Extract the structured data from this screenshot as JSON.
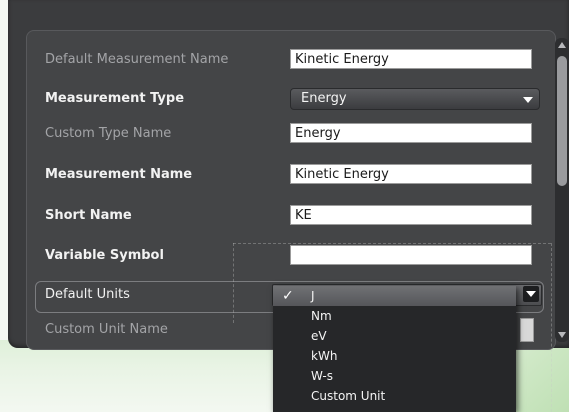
{
  "form": {
    "rows": [
      {
        "label": "Default Measurement Name",
        "value": "Kinetic Energy"
      },
      {
        "label": "Measurement Type",
        "value": "Energy"
      },
      {
        "label": "Custom Type Name",
        "value": "Energy"
      },
      {
        "label": "Measurement Name",
        "value": "Kinetic Energy"
      },
      {
        "label": "Short Name",
        "value": "KE"
      },
      {
        "label": "Variable Symbol",
        "value": ""
      },
      {
        "label": "Default Units",
        "value": "J"
      },
      {
        "label": "Custom Unit Name",
        "value": ""
      }
    ]
  },
  "units_dropdown": {
    "selected": "J",
    "options": [
      "J",
      "Nm",
      "eV",
      "kWh",
      "W-s",
      "Custom Unit"
    ]
  },
  "colors": {
    "window_bg": "#3b3c3e",
    "panel_bg": "#444547",
    "dropdown_bg": "#262729",
    "selected_item": "#5f6063"
  }
}
